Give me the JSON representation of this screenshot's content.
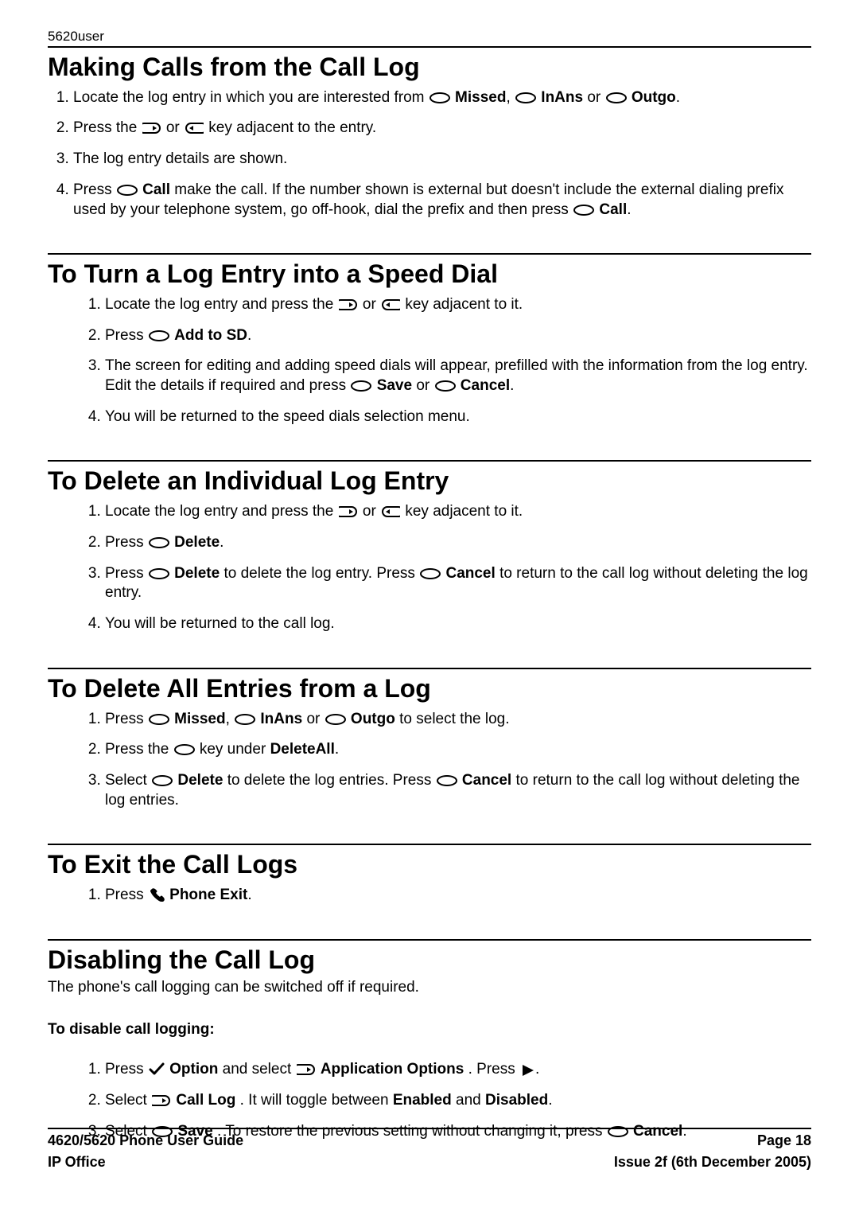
{
  "top_label": "5620user",
  "sections": {
    "making": {
      "title": "Making Calls from the Call Log",
      "items": [
        {
          "pre": "Locate the log entry in which you are interested from ",
          "k1": "Missed",
          "mid1": ", ",
          "k2": "InAns",
          "mid2": " or ",
          "k3": "Outgo",
          "post": "."
        },
        {
          "pre": "Press the ",
          "post": " key adjacent to the entry."
        },
        {
          "text": "The log entry details are shown."
        },
        {
          "pre": "Press ",
          "k1": "Call",
          "mid1": " make the call. If the number shown is external but doesn't include the external dialing prefix used by your telephone system, go off-hook, dial the prefix and then press ",
          "k2": "Call",
          "post": "."
        }
      ]
    },
    "speed": {
      "title": "To Turn a Log Entry into a Speed Dial",
      "items": [
        {
          "pre": "Locate the log entry and press the ",
          "post": " key adjacent to it."
        },
        {
          "pre": "Press ",
          "k1": "Add to SD",
          "post": "."
        },
        {
          "pre": "The screen for editing and adding speed dials will appear, prefilled with the information from the log entry. Edit the details if required and press ",
          "k1": "Save",
          "mid1": " or ",
          "k2": "Cancel",
          "post": "."
        },
        {
          "text": "You will be returned to the speed dials selection menu."
        }
      ]
    },
    "delete_one": {
      "title": "To Delete an Individual Log Entry",
      "items": [
        {
          "pre": "Locate the log entry and press the ",
          "post": " key adjacent to it."
        },
        {
          "pre": "Press ",
          "k1": "Delete",
          "post": "."
        },
        {
          "pre": "Press ",
          "k1": "Delete",
          "mid1": " to delete the log entry. Press ",
          "k2": "Cancel",
          "post": " to return to the call log without deleting the log entry."
        },
        {
          "text": "You will be returned to the call log."
        }
      ]
    },
    "delete_all": {
      "title": "To Delete All Entries from a Log",
      "items": [
        {
          "pre": "Press ",
          "k1": "Missed",
          "mid1": ", ",
          "k2": "InAns",
          "mid2": " or ",
          "k3": "Outgo",
          "post": " to select the log."
        },
        {
          "pre": "Press the ",
          "mid1": " key under ",
          "k1": "DeleteAll",
          "post": "."
        },
        {
          "pre": "Select ",
          "k1": "Delete",
          "mid1": " to delete the log entries. Press ",
          "k2": "Cancel",
          "post": " to return to the call log without deleting the log entries."
        }
      ]
    },
    "exit": {
      "title": "To Exit the Call Logs",
      "items": [
        {
          "pre": "Press ",
          "k1": "Phone Exit",
          "post": "."
        }
      ]
    },
    "disable": {
      "title": "Disabling the Call Log",
      "intro": "The phone's call logging can be switched off if required.",
      "subhead": "To disable call logging:",
      "items": [
        {
          "pre": "Press ",
          "k1": "Option",
          "mid1": " and select ",
          "k2": "Application Options",
          "mid2": ". Press ",
          "post": "."
        },
        {
          "pre": "Select ",
          "k1": "Call Log",
          "mid1": ". It will toggle between ",
          "k2": "Enabled",
          "mid2": " and ",
          "k3": "Disabled",
          "post": "."
        },
        {
          "pre": "Select ",
          "k1": "Save",
          "mid1": ". To restore the previous setting without changing it, press ",
          "k2": "Cancel",
          "post": "."
        }
      ]
    }
  },
  "footer": {
    "left1": "4620/5620 Phone User Guide",
    "right1": "Page 18",
    "left2": "IP Office",
    "right2": "Issue 2f (6th December 2005)"
  }
}
